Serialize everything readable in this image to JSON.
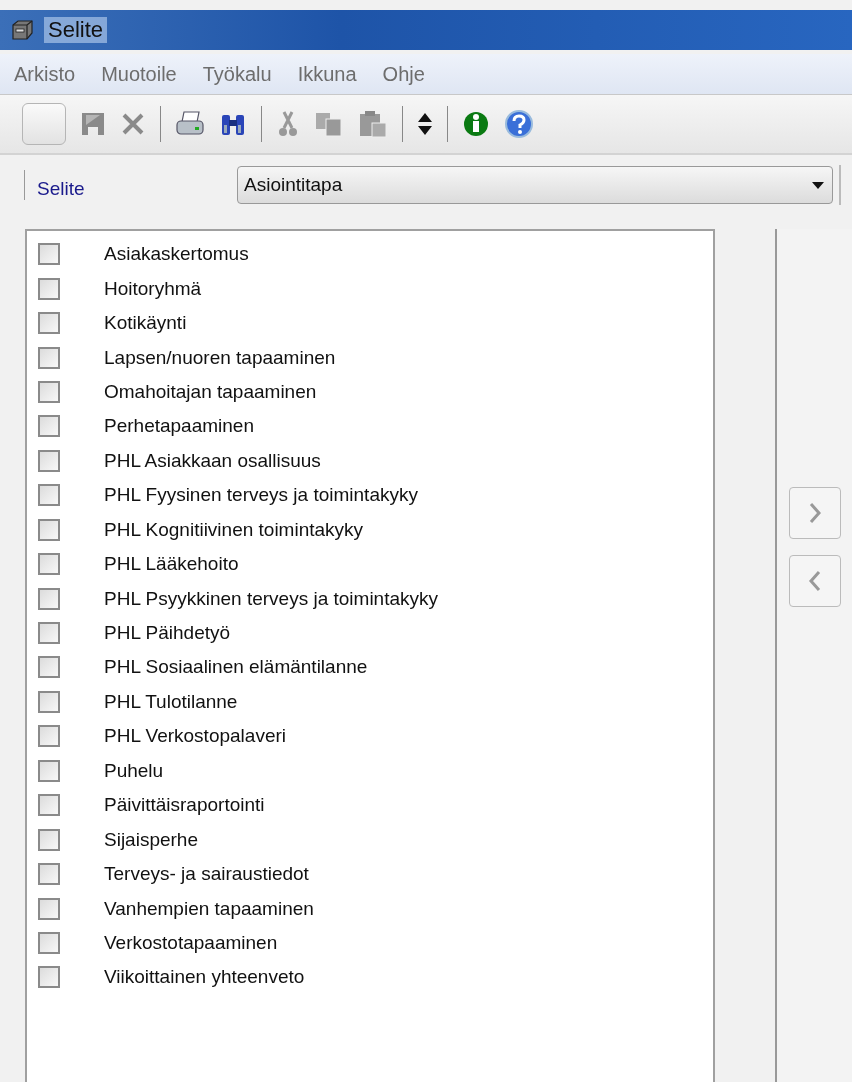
{
  "window": {
    "title": "Selite"
  },
  "menu": [
    "Arkisto",
    "Muotoile",
    "Työkalu",
    "Ikkuna",
    "Ohje"
  ],
  "filter": {
    "label": "Selite",
    "value": "Asiointitapa"
  },
  "items": [
    {
      "label": "Asiakaskertomus",
      "checked": false
    },
    {
      "label": "Hoitoryhmä",
      "checked": false
    },
    {
      "label": "Kotikäynti",
      "checked": false
    },
    {
      "label": "Lapsen/nuoren tapaaminen",
      "checked": false
    },
    {
      "label": "Omahoitajan tapaaminen",
      "checked": false
    },
    {
      "label": "Perhetapaaminen",
      "checked": false
    },
    {
      "label": "PHL Asiakkaan osallisuus",
      "checked": false
    },
    {
      "label": "PHL Fyysinen terveys ja toimintakyky",
      "checked": false
    },
    {
      "label": "PHL Kognitiivinen toimintakyky",
      "checked": false
    },
    {
      "label": "PHL Lääkehoito",
      "checked": false
    },
    {
      "label": "PHL Psyykkinen terveys ja toimintakyky",
      "checked": false
    },
    {
      "label": "PHL Päihdetyö",
      "checked": false
    },
    {
      "label": "PHL Sosiaalinen elämäntilanne",
      "checked": false
    },
    {
      "label": "PHL Tulotilanne",
      "checked": false
    },
    {
      "label": "PHL Verkostopalaveri",
      "checked": false
    },
    {
      "label": "Puhelu",
      "checked": false
    },
    {
      "label": "Päivittäisraportointi",
      "checked": false
    },
    {
      "label": "Sijaisperhe",
      "checked": false
    },
    {
      "label": "Terveys- ja sairaustiedot",
      "checked": false
    },
    {
      "label": "Vanhempien tapaaminen",
      "checked": false
    },
    {
      "label": "Verkostotapaaminen",
      "checked": false
    },
    {
      "label": "Viikoittainen yhteenveto",
      "checked": false
    }
  ]
}
